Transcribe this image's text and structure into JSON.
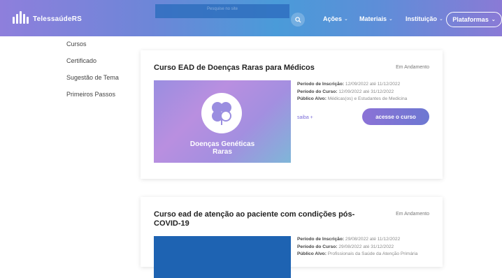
{
  "header": {
    "logo_text": "TelessaúdeRS",
    "search_placeholder": "Pesquise no site",
    "nav": [
      {
        "label": "Ações"
      },
      {
        "label": "Materiais"
      },
      {
        "label": "Instituição"
      }
    ],
    "platforms_label": "Plataformas"
  },
  "sidebar": {
    "items": [
      {
        "label": "Cursos"
      },
      {
        "label": "Certificado"
      },
      {
        "label": "Sugestão de Tema"
      },
      {
        "label": "Primeiros Passos"
      }
    ]
  },
  "courses": [
    {
      "title": "Curso EAD de Doenças Raras para Médicos",
      "status": "Em Andamento",
      "image_caption_line1": "Doenças Genéticas",
      "image_caption_line2": "Raras",
      "inscricao_label": "Período de Inscrição:",
      "inscricao_value": "12/09/2022 até 11/12/2022",
      "curso_label": "Período do Curso:",
      "curso_value": "12/09/2022 até 31/12/2022",
      "publico_label": "Público Alvo:",
      "publico_value": "Médicas(os) e Estudantes de Medicina",
      "saiba_label": "saiba +",
      "access_label": "acesse o curso"
    },
    {
      "title_line1": "Curso ead de atenção ao paciente com condições pós-",
      "title_line2": "COVID-19",
      "status": "Em Andamento",
      "inscricao_label": "Período de Inscrição:",
      "inscricao_value": "29/08/2022 até 11/12/2022",
      "curso_label": "Período do Curso:",
      "curso_value": "29/08/2022 até 31/12/2022",
      "publico_label": "Público Alvo:",
      "publico_value": "Profissionais da Saúde da Atenção Primária"
    }
  ],
  "colors": {
    "accent_purple": "#7b6cd8",
    "header_blue": "#4a9bd9",
    "course2_image": "#1e63b2"
  }
}
